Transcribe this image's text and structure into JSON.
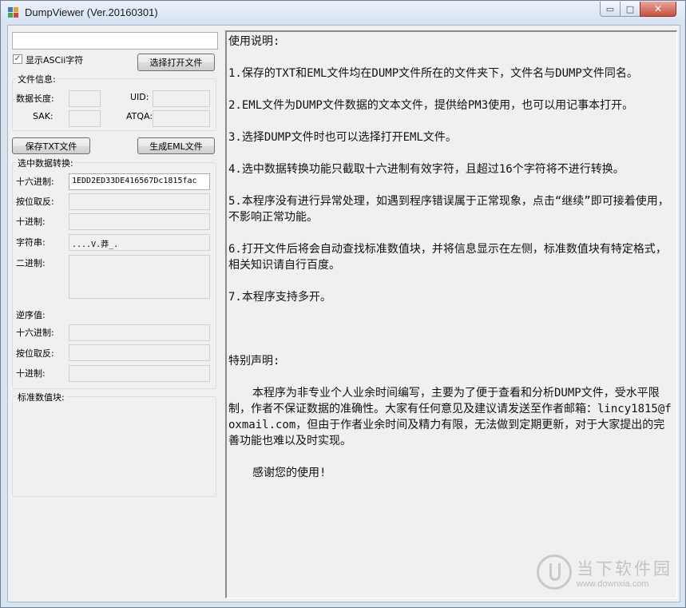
{
  "window": {
    "title": "DumpViewer (Ver.20160301)",
    "controls": {
      "minimize": "▭",
      "maximize": "□",
      "close": "✕"
    }
  },
  "left": {
    "path_input": {
      "value": ""
    },
    "ascii_checkbox": {
      "label": "显示ASCii字符",
      "checked": true,
      "mark": "✓"
    },
    "open_button": "选择打开文件",
    "file_info": {
      "title": "文件信息:",
      "data_length_label": "数据长度:",
      "uid_label": "UID:",
      "sak_label": "SAK:",
      "atqa_label": "ATQA:",
      "data_length": "",
      "uid": "",
      "sak": "",
      "atqa": ""
    },
    "save_txt_button": "保存TXT文件",
    "gen_eml_button": "生成EML文件",
    "conversion": {
      "title": "选中数据转换:",
      "hex_label": "十六进制:",
      "hex_value": "1EDD2ED33DE416567Dc1815fac",
      "invert_label": "按位取反:",
      "invert_value": "",
      "dec_label": "十进制:",
      "dec_value": "",
      "string_label": "字符串:",
      "string_value": "....V.莽_.",
      "bin_label": "二进制:",
      "bin_value": "",
      "reverse_title": "逆序值:",
      "rev_hex_label": "十六进制:",
      "rev_hex_value": "",
      "rev_invert_label": "按位取反:",
      "rev_invert_value": "",
      "rev_dec_label": "十进制:",
      "rev_dec_value": ""
    },
    "standard_block": {
      "title": "标准数值块:"
    }
  },
  "instructions": {
    "heading": "使用说明:",
    "items": [
      "1.保存的TXT和EML文件均在DUMP文件所在的文件夹下，文件名与DUMP文件同名。",
      "2.EML文件为DUMP文件数据的文本文件，提供给PM3使用，也可以用记事本打开。",
      "3.选择DUMP文件时也可以选择打开EML文件。",
      "4.选中数据转换功能只截取十六进制有效字符，且超过16个字符将不进行转换。",
      "5.本程序没有进行异常处理，如遇到程序错误属于正常现象，点击“继续”即可接着使用，不影响正常功能。",
      "6.打开文件后将会自动查找标准数值块，并将信息显示在左侧，标准数值块有特定格式，相关知识请自行百度。",
      "7.本程序支持多开。"
    ],
    "special_heading": "特别声明:",
    "statement": "本程序为非专业个人业余时间编写，主要为了便于查看和分析DUMP文件，受水平限制，作者不保证数据的准确性。大家有任何意见及建议请发送至作者邮箱：lincy1815@foxmail.com，但由于作者业余时间及精力有限，无法做到定期更新，对于大家提出的完善功能也难以及时实现。",
    "thanks": "感谢您的使用!"
  },
  "watermark": {
    "text": "当下软件园",
    "url": "www.downxia.com"
  },
  "colors": {
    "titlebar": "#dbe6f3",
    "close": "#c7503c",
    "panel": "#f0f0f0"
  }
}
